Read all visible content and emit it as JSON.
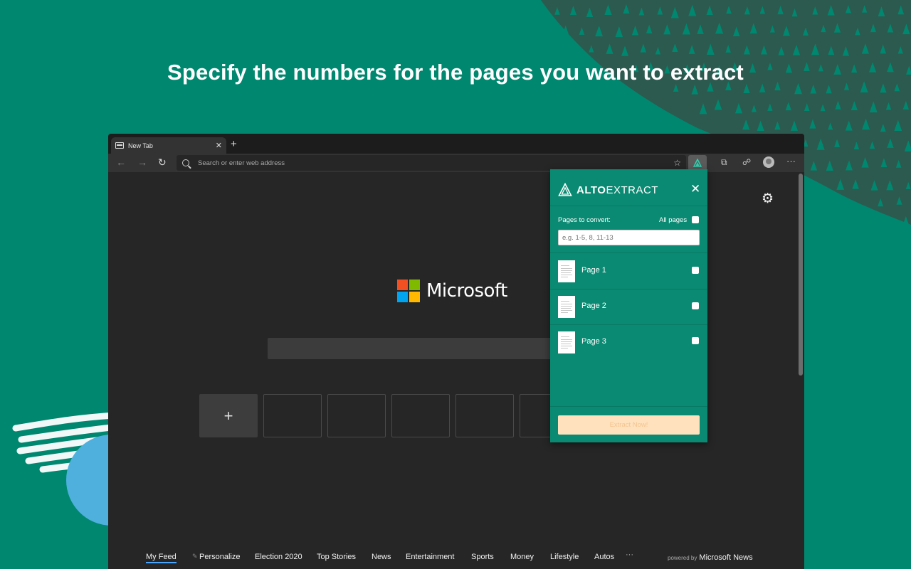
{
  "headline": "Specify the numbers for the pages you want to extract",
  "browser": {
    "tab_title": "New Tab",
    "tab_close": "✕",
    "new_tab": "+",
    "back": "←",
    "forward": "→",
    "refresh": "↻",
    "address_placeholder": "Search or enter web address",
    "favorite": "☆",
    "more": "···"
  },
  "newtab": {
    "brand": "Microsoft",
    "add_tile": "+",
    "feed": [
      {
        "label": "My Feed"
      },
      {
        "label": "Personalize"
      },
      {
        "label": "Election 2020"
      },
      {
        "label": "Top Stories"
      },
      {
        "label": "News"
      },
      {
        "label": "Entertainment"
      },
      {
        "label": "Sports"
      },
      {
        "label": "Money"
      },
      {
        "label": "Lifestyle"
      },
      {
        "label": "Autos"
      }
    ],
    "feed_more": "···",
    "powered_prefix": "powered by",
    "powered_brand": "Microsoft News"
  },
  "popup": {
    "brand_bold": "ALTO",
    "brand_light": "EXTRACT",
    "close": "✕",
    "pages_to_convert": "Pages to convert:",
    "all_pages": "All pages",
    "range_placeholder": "e.g. 1-5, 8, 11-13",
    "pages": [
      {
        "label": "Page 1"
      },
      {
        "label": "Page 2"
      },
      {
        "label": "Page 3"
      }
    ],
    "extract_button": "Extract Now!"
  },
  "colors": {
    "background": "#00876f",
    "popup": "#0a8a72",
    "extract_button": "#ffe1bd",
    "ms_red": "#f25022",
    "ms_green": "#7fba00",
    "ms_blue": "#00a4ef",
    "ms_yellow": "#ffb900"
  }
}
